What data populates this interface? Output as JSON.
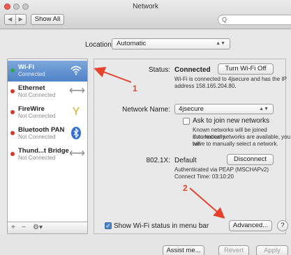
{
  "window": {
    "title": "Network"
  },
  "toolbar": {
    "back_glyph": "◀",
    "forward_glyph": "▶",
    "show_all": "Show All",
    "search_glyph": "Q"
  },
  "location": {
    "label": "Location:",
    "value": "Automatic"
  },
  "services": [
    {
      "name": "Wi-Fi",
      "status": "Connected",
      "icon": "wifi-icon",
      "dot": "#2ea94b",
      "selected": true
    },
    {
      "name": "Ethernet",
      "status": "Not Connected",
      "icon": "ethernet-icon",
      "dot": "#d33a2c",
      "selected": false
    },
    {
      "name": "FireWire",
      "status": "Not Connected",
      "icon": "firewire-icon",
      "dot": "#d33a2c",
      "selected": false
    },
    {
      "name": "Bluetooth PAN",
      "status": "Not Connected",
      "icon": "bluetooth-icon",
      "dot": "#d33a2c",
      "selected": false
    },
    {
      "name": "Thund...t Bridge",
      "status": "Not Connected",
      "icon": "thunderbolt-icon",
      "dot": "#d33a2c",
      "selected": false
    }
  ],
  "sidebar_controls": {
    "add": "+",
    "remove": "−",
    "gear": "⚙▾"
  },
  "detail": {
    "status_label": "Status:",
    "status_value": "Connected",
    "turn_off_button": "Turn Wi-Fi Off",
    "status_desc_1": "Wi-Fi is connected to 4jsecure and has the IP",
    "status_desc_2": "address 158.165.204.80.",
    "network_name_label": "Network Name:",
    "network_name_value": "4jsecure",
    "ask_join_label": "Ask to join new networks",
    "ask_join_desc_1": "Known networks will be joined automatically.",
    "ask_join_desc_2": "If no known networks are available, you will",
    "ask_join_desc_3": "have to manually select a network.",
    "dot1x_label": "802.1X:",
    "dot1x_value": "Default",
    "disconnect_button": "Disconnect",
    "auth_desc_1": "Authenticated via PEAP (MSCHAPv2)",
    "auth_desc_2": "Connect Time: 03:10:20",
    "show_status_label": "Show Wi-Fi status in menu bar",
    "advanced_button": "Advanced...",
    "help_button": "?"
  },
  "footer": {
    "assist": "Assist me...",
    "revert": "Revert",
    "apply": "Apply"
  },
  "annotations": {
    "one": "1",
    "two": "2"
  },
  "colors": {
    "annotation": "#e8412b",
    "selection": "#4f82c8"
  }
}
